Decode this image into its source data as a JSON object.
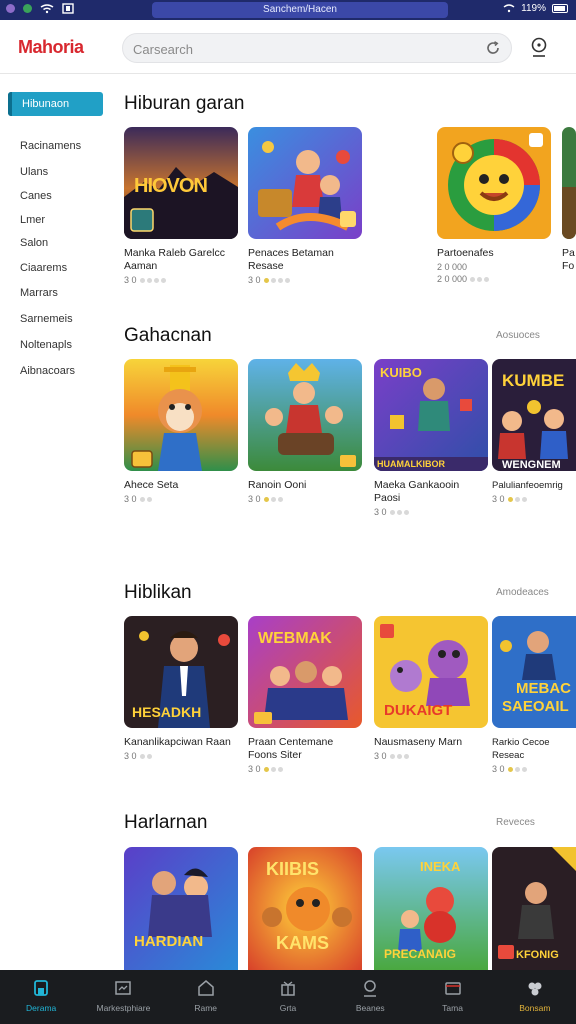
{
  "status_bar": {
    "url": "Sanchem/Hacen",
    "battery": "119%"
  },
  "header": {
    "logo": "Mahoria",
    "search_placeholder": "Carsearch"
  },
  "sidebar": {
    "active": "Hibunaon",
    "items": [
      "Racinamens",
      "Ulans",
      "Canes",
      "Lmer",
      "Salon",
      "Ciaarems",
      "Marrars",
      "Sarnemeis",
      "Noltenapls",
      "Aibnacoars"
    ]
  },
  "sections": [
    {
      "title": "Hiburan garan",
      "more": "",
      "cards": [
        {
          "title": "Manka Raleb Garelcc Aaman",
          "rating": "3 0",
          "thumb_text": "HIOVON"
        },
        {
          "title": "Penaces Betaman Resase",
          "rating": "3 0",
          "thumb_text": ""
        },
        {
          "title": "Partoenafes",
          "rating": "2 0 000",
          "rating2": "2 0 000",
          "thumb_text": ""
        },
        {
          "title": "Pa Fo",
          "rating": "",
          "thumb_text": ""
        }
      ]
    },
    {
      "title": "Gahacnan",
      "more": "Aosuoces",
      "cards": [
        {
          "title": "Ahece Seta",
          "rating": "3 0",
          "thumb_text": ""
        },
        {
          "title": "Ranoin Ooni",
          "rating": "3 0",
          "thumb_text": ""
        },
        {
          "title": "Maeka Gankaooin Paosi",
          "rating": "3 0",
          "thumb_text": "HUAMALKIBOR",
          "thumb_top": "KUIBO"
        },
        {
          "title": "Palulianfeoemrig",
          "rating": "3 0",
          "thumb_text": "WENGNEM",
          "thumb_top": "KUMBE"
        }
      ]
    },
    {
      "title": "Hiblikan",
      "more": "Amodeaces",
      "cards": [
        {
          "title": "Kananlikapciwan Raan",
          "rating": "3 0",
          "thumb_text": "HESADKH"
        },
        {
          "title": "Praan Centemane Foons Siter",
          "rating": "3 0",
          "thumb_text": "",
          "thumb_top": "WEBMAK"
        },
        {
          "title": "Nausmaseny Marn",
          "rating": "3 0",
          "thumb_text": "DUKAIGT"
        },
        {
          "title": "Rarkio Cecoe Reseac",
          "rating": "3 0",
          "thumb_text": "SAEOAIL",
          "thumb_top": "MEBAC"
        }
      ]
    },
    {
      "title": "Harlarnan",
      "more": "Reveces",
      "cards": [
        {
          "title": "",
          "rating": "",
          "thumb_text": "HARDIAN"
        },
        {
          "title": "",
          "rating": "",
          "thumb_text": "KAMS",
          "thumb_top": "KIIBIS"
        },
        {
          "title": "",
          "rating": "",
          "thumb_text": "PRECANAIG",
          "thumb_top": "INEKA"
        },
        {
          "title": "",
          "rating": "",
          "thumb_text": "KFONIG"
        }
      ]
    }
  ],
  "bottom_nav": [
    "Derama",
    "Markestphiare",
    "Rame",
    "Grta",
    "Beanes",
    "Tama",
    "Bonsam"
  ],
  "colors": {
    "accent": "#21a0c6",
    "logo": "#d8282f",
    "nav_bg": "#1a1c1f",
    "status_bg": "#1f2a6b"
  }
}
